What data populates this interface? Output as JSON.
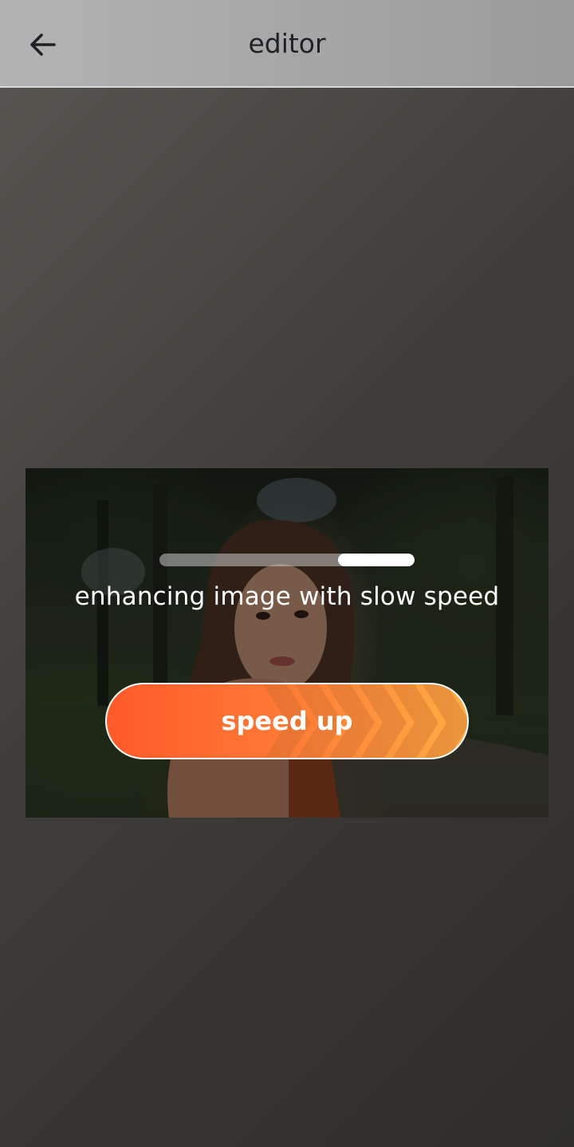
{
  "app_bar": {
    "title": "editor",
    "back_icon": "arrow-left-icon"
  },
  "enhance": {
    "progress": {
      "fill_start": 0.7,
      "fill_end": 1.0
    },
    "status_text": "enhancing image with slow speed",
    "button_label": "speed up",
    "button_icon": "chevrons-right-icon"
  },
  "colors": {
    "button_gradient_start": "#ff5a2a",
    "button_gradient_end": "#ffae45",
    "app_bar": "#a7a7a7"
  }
}
